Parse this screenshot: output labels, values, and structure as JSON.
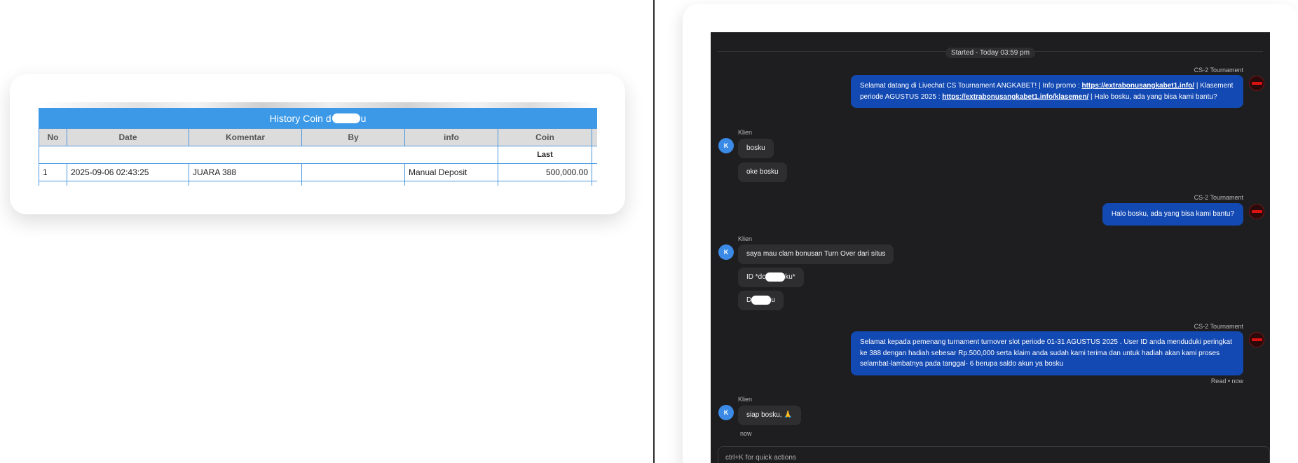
{
  "history": {
    "title_prefix": "History Coin d",
    "title_suffix": "u",
    "columns": [
      "No",
      "Date",
      "Komentar",
      "By",
      "info",
      "Coin"
    ],
    "subheader_last": "Last",
    "rows": [
      {
        "no": "1",
        "date": "2025-09-06 02:43:25",
        "komentar": "JUARA 388",
        "by": "",
        "info": "Manual Deposit",
        "coin": "500,000.00"
      }
    ]
  },
  "chat": {
    "started": "Started - Today 03:59 pm",
    "agent_name": "CS-2 Tournament",
    "client_name": "Klien",
    "client_initial": "K",
    "msg1": {
      "part1": "Selamat datang di Livechat CS Tournament ANGKABET! | Info promo : ",
      "link1": "https://extrabonusangkabet1.info/",
      "part2": " | Klasement periode AGUSTUS 2025 : ",
      "link2": "https://extrabonusangkabet1.info/klasemen/",
      "part3": " | Halo bosku, ada yang bisa kami bantu?"
    },
    "c1a": "bosku",
    "c1b": "oke bosku",
    "msg2": "Halo bosku, ada yang bisa kami bantu?",
    "c2a": "saya mau clam bonusan Turn Over dari situs",
    "c2b_pre": "ID *dc",
    "c2b_post": "ku*",
    "c2c_pre": "D",
    "c2c_post": "u",
    "msg3": "Selamat kepada pemenang turnament turnover slot periode 01-31 AGUSTUS 2025 . User ID anda menduduki peringkat ke 388 dengan hadiah sebesar Rp.500,000 serta klaim anda sudah kami terima dan untuk hadiah akan kami proses selambat-lambatnya pada tanggal- 6 berupa saldo akun ya bosku",
    "read_status": "Read • now",
    "c3": "siap bosku, 🙏",
    "c3_time": "now",
    "composer_placeholder": "ctrl+K for quick actions"
  }
}
